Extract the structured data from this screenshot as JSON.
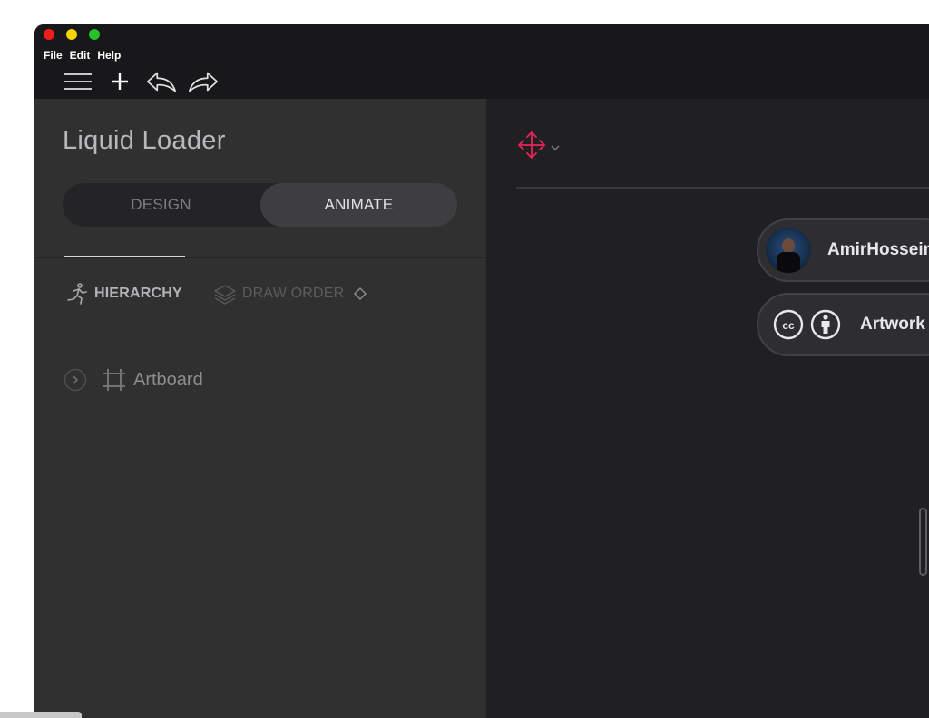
{
  "window": {
    "traffic_lights": [
      "#ee1c1c",
      "#f5d400",
      "#26c22a"
    ]
  },
  "menubar": {
    "items": [
      "File",
      "Edit",
      "Help"
    ]
  },
  "toolbar": {
    "icons": [
      "hamburger-menu-icon",
      "plus-icon",
      "undo-icon",
      "redo-icon"
    ]
  },
  "sidebar": {
    "project_title": "Liquid Loader",
    "mode_toggle": {
      "design_label": "DESIGN",
      "animate_label": "ANIMATE",
      "selected": "ANIMATE"
    },
    "panel_tabs": {
      "hierarchy_label": "HIERARCHY",
      "draw_order_label": "DRAW ORDER",
      "selected": "HIERARCHY"
    },
    "tree": [
      {
        "label": "Artboard",
        "icon": "artboard-icon",
        "expanded": false
      }
    ]
  },
  "stage": {
    "tool_icon": "move-tool-icon",
    "accent_color": "#e8245a",
    "author_name": "AmirHossein",
    "license_label": "Artwork"
  }
}
